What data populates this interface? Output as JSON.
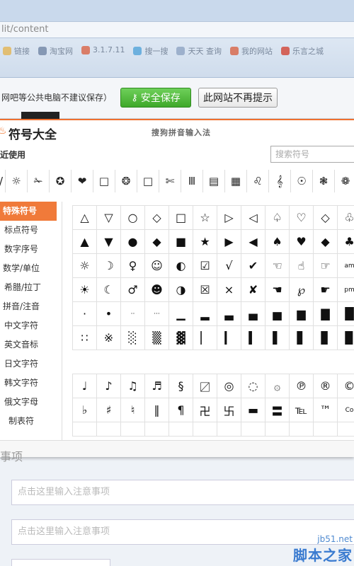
{
  "browser": {
    "address_text": "lit/content",
    "bookmarks": [
      {
        "icon": "folder-icon",
        "label": "链接",
        "color": "#e5b24a"
      },
      {
        "icon": "user-icon",
        "label": "淘宝网",
        "color": "#6a7fa0"
      },
      {
        "icon": "pin-icon",
        "label": "3.1.7.11",
        "color": "#d95b3a"
      },
      {
        "icon": "search-icon",
        "label": "搜一搜",
        "color": "#4aa0d8"
      },
      {
        "icon": "page-icon",
        "label": "天天 查询",
        "color": "#8aa0c0"
      },
      {
        "icon": "pin-icon",
        "label": "我的网站",
        "color": "#d95b3a"
      },
      {
        "icon": "le-icon",
        "label": "乐言之城",
        "color": "#d23a2a"
      }
    ]
  },
  "password_bar": {
    "text": "网吧等公共电脑不建议保存）",
    "save_button": "安全保存",
    "no_prompt_button": "此网站不再提示"
  },
  "panel": {
    "title": "符号大全",
    "brand": "搜狗拼音输入法",
    "recent_label": "近使用",
    "search_placeholder": "搜索符号",
    "recent_symbols": [
      "/",
      "☼",
      "✁",
      "✪",
      "❤",
      "□",
      "❂",
      "□",
      "✄",
      "Ⅲ",
      "▤",
      "▦",
      "♌",
      "𝄞",
      "☉",
      "❃",
      "❁"
    ],
    "categories": [
      {
        "label": "特殊符号",
        "active": true
      },
      {
        "label": "标点符号",
        "active": false
      },
      {
        "label": "数字序号",
        "active": false
      },
      {
        "label": "数学/单位",
        "active": false
      },
      {
        "label": "希腊/拉丁",
        "active": false
      },
      {
        "label": "拼音/注音",
        "active": false
      },
      {
        "label": "中文字符",
        "active": false
      },
      {
        "label": "英文音标",
        "active": false
      },
      {
        "label": "日文字符",
        "active": false
      },
      {
        "label": "韩文字符",
        "active": false
      },
      {
        "label": "俄文字母",
        "active": false
      },
      {
        "label": "制表符",
        "active": false
      }
    ],
    "grid1": [
      [
        "△",
        "▽",
        "○",
        "◇",
        "□",
        "☆",
        "▷",
        "◁",
        "♤",
        "♡",
        "◇",
        "♧"
      ],
      [
        "▲",
        "▼",
        "●",
        "◆",
        "■",
        "★",
        "▶",
        "◀",
        "♠",
        "♥",
        "◆",
        "♣"
      ],
      [
        "☼",
        "☽",
        "♀",
        "☺",
        "◐",
        "☑",
        "√",
        "✔",
        "☜",
        "☝",
        "☞",
        "am"
      ],
      [
        "☀",
        "☾",
        "♂",
        "☻",
        "◑",
        "☒",
        "×",
        "✘",
        "☚",
        "℘",
        "☛",
        "pm"
      ],
      [
        "·",
        "•",
        "··",
        "···",
        "▁",
        "▂",
        "▃",
        "▄",
        "▅",
        "▆",
        "▇",
        "█"
      ],
      [
        "∷",
        "※",
        "░",
        "▒",
        "▓",
        "▏",
        "▎",
        "▍",
        "▌",
        "▋",
        "▊",
        "▉"
      ]
    ],
    "grid2": [
      [
        "♩",
        "♪",
        "♫",
        "♬",
        "§",
        "〼",
        "◎",
        "◌",
        "۞",
        "℗",
        "®",
        "©"
      ],
      [
        "♭",
        "♯",
        "♮",
        "‖",
        "¶",
        "卍",
        "卐",
        "▬",
        "〓",
        "℡",
        "™",
        "Co"
      ],
      [
        "",
        "",
        "",
        "",
        "",
        "",
        "",
        "",
        "",
        "",
        "",
        ""
      ]
    ]
  },
  "page": {
    "partial_heading": "事项",
    "note_placeholder_1": "点击这里输入注意事项",
    "note_placeholder_2": "点击这里输入注意事项"
  },
  "watermark": {
    "url": "jb51.net",
    "name": "脚本之家"
  }
}
